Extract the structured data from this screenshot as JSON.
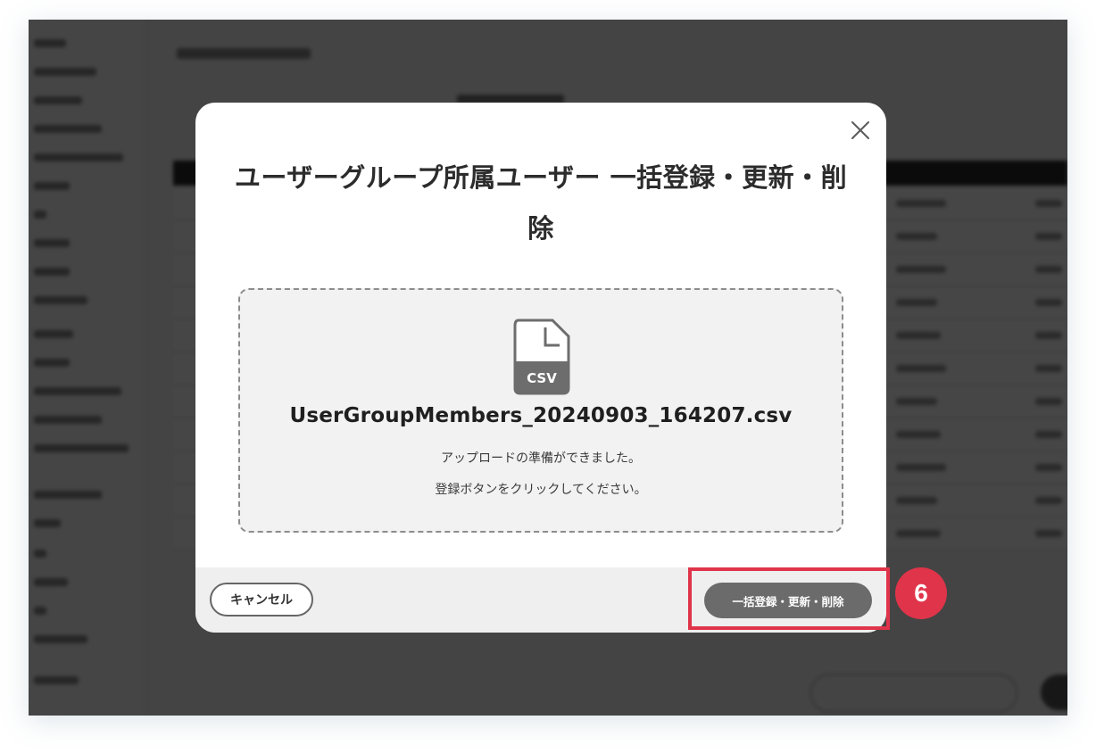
{
  "modal": {
    "title": "ユーザーグループ所属ユーザー 一括登録・更新・削除",
    "file": {
      "icon": "csv-file-icon",
      "icon_label": "CSV",
      "name": "UserGroupMembers_20240903_164207.csv"
    },
    "messages": [
      "アップロードの準備ができました。",
      "登録ボタンをクリックしてください。"
    ],
    "cancel_label": "キャンセル",
    "submit_label": "一括登録・更新・削除"
  },
  "annotation": {
    "step_number": "6",
    "color": "#e0344a"
  },
  "colors": {
    "overlay": "rgba(0,0,0,0.72)",
    "submit_button": "#6b6b6b"
  }
}
